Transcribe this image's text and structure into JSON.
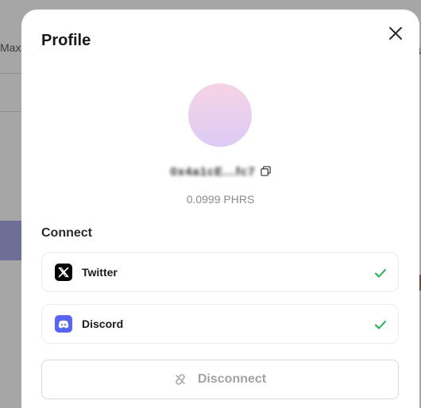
{
  "background": {
    "left_text": "Max",
    "right_text": "a"
  },
  "modal": {
    "title": "Profile",
    "close_icon": "close-icon",
    "avatar_gradient": [
      "#f6d3e4",
      "#dccbf6"
    ],
    "address": "0x4a1cE...fc7",
    "balance": "0.0999 PHRS",
    "connect_label": "Connect",
    "connections": [
      {
        "name": "Twitter",
        "icon": "x-twitter-icon",
        "connected": true
      },
      {
        "name": "Discord",
        "icon": "discord-icon",
        "connected": true
      }
    ],
    "disconnect_label": "Disconnect",
    "colors": {
      "check": "#22b14c",
      "discord": "#5865f2",
      "muted_text": "#a3a3a3"
    }
  }
}
